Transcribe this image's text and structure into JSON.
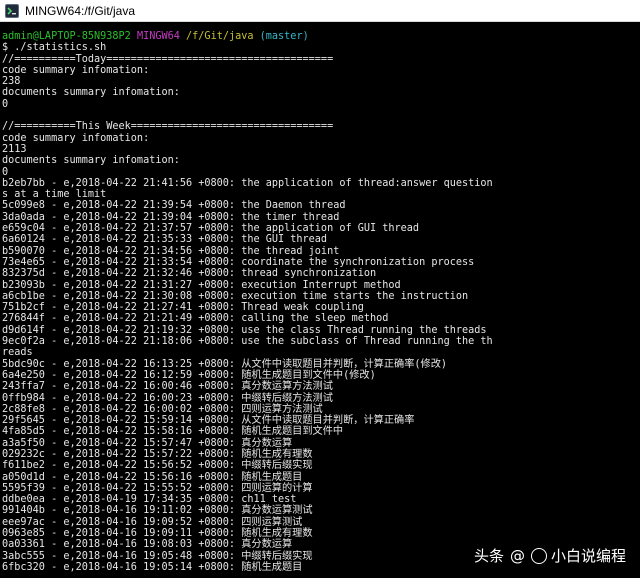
{
  "window": {
    "title": "MINGW64:/f/Git/java",
    "icon": "mingw-terminal-icon"
  },
  "prompt": {
    "user_host": "admin@LAPTOP-85N938P2",
    "env": "MINGW64",
    "path": "/f/Git/java",
    "branch": "(master)",
    "command": "$ ./statistics.sh"
  },
  "output_lines": [
    "//==========Today=====================================",
    "code summary infomation:",
    "238",
    "documents summary infomation:",
    "0",
    "",
    "//==========This Week=================================",
    "code summary infomation:",
    "2113",
    "documents summary infomation:",
    "0",
    "b2eb7bb - e,2018-04-22 21:41:56 +0800: the application of thread:answer question",
    "s at a time limit",
    "5c099e8 - e,2018-04-22 21:39:54 +0800: the Daemon thread",
    "3da0ada - e,2018-04-22 21:39:04 +0800: the timer thread",
    "e659c04 - e,2018-04-22 21:37:57 +0800: the application of GUI thread",
    "6a60124 - e,2018-04-22 21:35:33 +0800: the GUI thread",
    "b590070 - e,2018-04-22 21:34:56 +0800: the thread joint",
    "73e4e65 - e,2018-04-22 21:33:54 +0800: coordinate the synchronization process",
    "832375d - e,2018-04-22 21:32:46 +0800: thread synchronization",
    "b23093b - e,2018-04-22 21:31:27 +0800: execution Interrupt method",
    "a6cb1be - e,2018-04-22 21:30:08 +0800: execution time starts the instruction",
    "751b2cf - e,2018-04-22 21:27:41 +0800: Thread weak coupling",
    "276844f - e,2018-04-22 21:21:49 +0800: calling the sleep method",
    "d9d614f - e,2018-04-22 21:19:32 +0800: use the class Thread running the threads",
    "9ec0f2a - e,2018-04-22 21:18:06 +0800: use the subclass of Thread running the th",
    "reads",
    "5bdc90c - e,2018-04-22 16:13:25 +0800: 从文件中读取题目并判断，计算正确率(修改)",
    "6a4e250 - e,2018-04-22 16:12:59 +0800: 随机生成题目到文件中(修改)",
    "243ffa7 - e,2018-04-22 16:00:46 +0800: 真分数运算方法测试",
    "0ffb984 - e,2018-04-22 16:00:23 +0800: 中缀转后缀方法测试",
    "2c88fe8 - e,2018-04-22 16:00:02 +0800: 四则运算方法测试",
    "29f5645 - e,2018-04-22 15:59:14 +0800: 从文件中读取题目并判断，计算正确率",
    "4fa85d5 - e,2018-04-22 15:58:16 +0800: 随机生成题目到文件中",
    "a3a5f50 - e,2018-04-22 15:57:47 +0800: 真分数运算",
    "029232c - e,2018-04-22 15:57:22 +0800: 随机生成有理数",
    "f611be2 - e,2018-04-22 15:56:52 +0800: 中缀转后缀实现",
    "a050d1d - e,2018-04-22 15:56:16 +0800: 随机生成题目",
    "5595f39 - e,2018-04-22 15:55:52 +0800: 四则运算的计算",
    "ddbe0ea - e,2018-04-19 17:34:35 +0800: ch11 test",
    "991404b - e,2018-04-16 19:11:02 +0800: 真分数运算测试",
    "eee97ac - e,2018-04-16 19:09:52 +0800: 四则运算测试",
    "0963e85 - e,2018-04-16 19:09:11 +0800: 随机生成有理数",
    "0a03361 - e,2018-04-16 19:08:03 +0800: 真分数运算",
    "3abc555 - e,2018-04-16 19:05:48 +0800: 中缀转后缀实现",
    "6fbc320 - e,2018-04-16 19:05:14 +0800: 随机生成题目"
  ],
  "watermark": {
    "brand": "头条",
    "separator": "@",
    "account": "小白说编程",
    "icon": "smiley-icon"
  },
  "colors": {
    "user_host": "#2cc02c",
    "env": "#c43bc4",
    "path": "#c8c031",
    "branch": "#35b8c8",
    "text": "#e6e6e6",
    "background": "#000000"
  }
}
